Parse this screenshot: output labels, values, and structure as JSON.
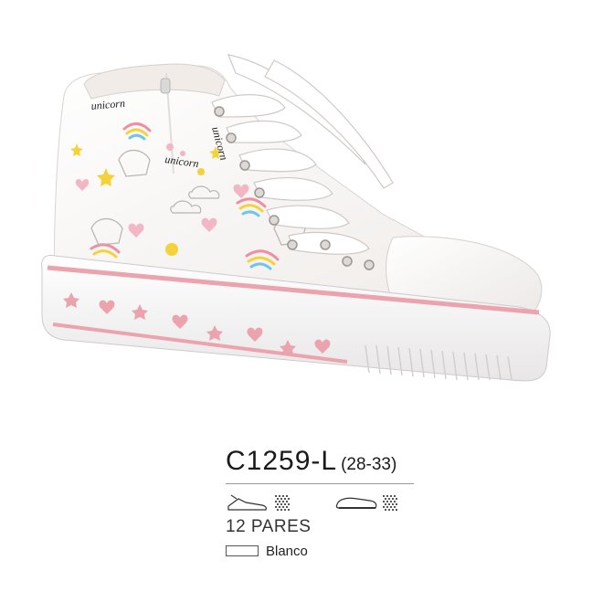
{
  "product": {
    "code": "C1259-L",
    "size_range": "(28-33)",
    "pairs": "12 PARES",
    "color_name": "Blanco"
  },
  "icons": {
    "upper": "shoe-upper-icon",
    "upper_material": "textile-pattern-icon",
    "sole": "shoe-sole-icon",
    "sole_material": "textile-pattern-icon"
  },
  "colors": {
    "shoe_base": "#f7f4f2",
    "stripe_pink": "#eba3ad",
    "heart_pink": "#f08ea4",
    "text": "#1a1a1a"
  }
}
